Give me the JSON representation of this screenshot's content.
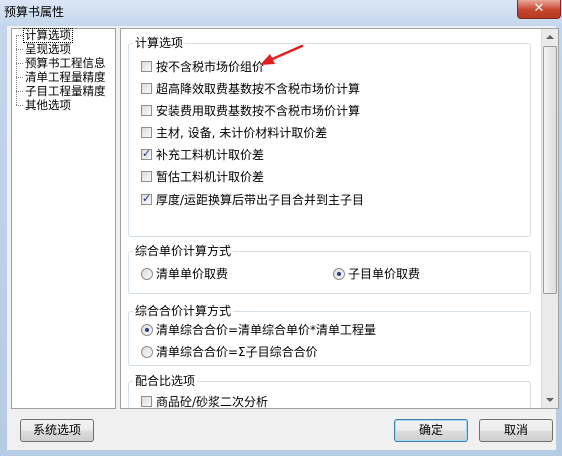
{
  "window": {
    "title": "预算书属性",
    "close_glyph": "✕"
  },
  "tree": {
    "items": [
      {
        "label": "计算选项",
        "selected": true
      },
      {
        "label": "呈现选项",
        "selected": false
      },
      {
        "label": "预算书工程信息",
        "selected": false
      },
      {
        "label": "清单工程量精度",
        "selected": false
      },
      {
        "label": "子目工程量精度",
        "selected": false
      },
      {
        "label": "其他选项",
        "selected": false
      }
    ]
  },
  "calc_options": {
    "group_title": "计算选项",
    "items": [
      {
        "label": "按不含税市场价组价",
        "checked": false
      },
      {
        "label": "超高降效取费基数按不含税市场价计算",
        "checked": false
      },
      {
        "label": "安装费用取费基数按不含税市场价计算",
        "checked": false
      },
      {
        "label": "主材, 设备, 未计价材料计取价差",
        "checked": false
      },
      {
        "label": "补充工料机计取价差",
        "checked": true
      },
      {
        "label": "暂估工料机计取价差",
        "checked": false
      },
      {
        "label": "厚度/运距换算后带出子目合并到主子目",
        "checked": true
      }
    ]
  },
  "unit_price_method": {
    "group_title": "综合单价计算方式",
    "options": [
      {
        "label": "清单单价取费",
        "selected": false
      },
      {
        "label": "子目单价取费",
        "selected": true
      }
    ]
  },
  "total_price_method": {
    "group_title": "综合合价计算方式",
    "options": [
      {
        "label": "清单综合合价=清单综合单价*清单工程量",
        "selected": true
      },
      {
        "label": "清单综合合价=Σ子目综合合价",
        "selected": false
      }
    ]
  },
  "mix_ratio": {
    "group_title": "配合比选项",
    "items": [
      {
        "label": "商品砼/砂浆二次分析",
        "checked": false
      }
    ]
  },
  "buttons": {
    "system_options": "系统选项",
    "ok": "确定",
    "cancel": "取消"
  },
  "colors": {
    "annotation_arrow": "#e02020",
    "check_mark": "#21318a"
  },
  "icons": {
    "close": "close-icon",
    "annotation": "red-arrow-icon"
  }
}
